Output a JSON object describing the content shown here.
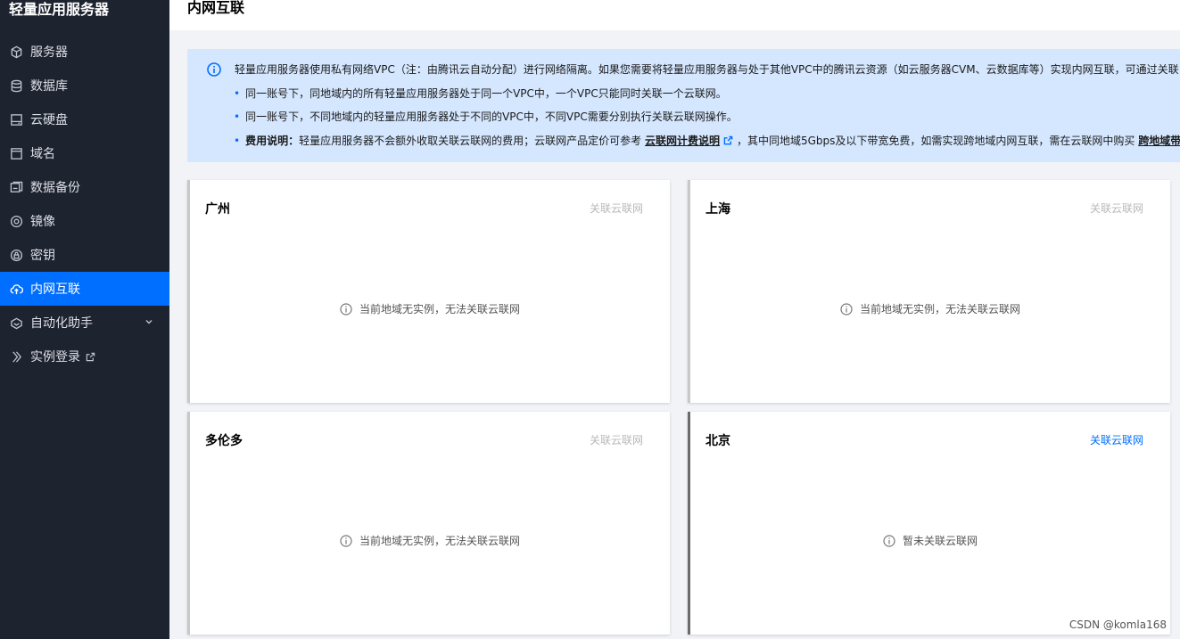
{
  "sidebar": {
    "title": "轻量应用服务器",
    "items": [
      {
        "label": "服务器",
        "icon": "cube-icon"
      },
      {
        "label": "数据库",
        "icon": "database-icon"
      },
      {
        "label": "云硬盘",
        "icon": "disk-icon"
      },
      {
        "label": "域名",
        "icon": "domain-icon"
      },
      {
        "label": "数据备份",
        "icon": "backup-icon"
      },
      {
        "label": "镜像",
        "icon": "image-icon"
      },
      {
        "label": "密钥",
        "icon": "key-icon"
      },
      {
        "label": "内网互联",
        "icon": "cloud-link-icon",
        "active": true
      },
      {
        "label": "自动化助手",
        "icon": "automation-icon",
        "has_submenu": true
      },
      {
        "label": "实例登录",
        "icon": "login-icon",
        "external": true
      }
    ]
  },
  "header": {
    "title": "内网互联"
  },
  "banner": {
    "intro": "轻量应用服务器使用私有网络VPC（注：由腾讯云自动分配）进行网络隔离。如果您需要将轻量应用服务器与处于其他VPC中的腾讯云资源（如云服务器CVM、云数据库等）实现内网互联，可通过关联",
    "bullet1": "同一账号下，同地域内的所有轻量应用服务器处于同一个VPC中，一个VPC只能同时关联一个云联网。",
    "bullet2": "同一账号下，不同地域内的轻量应用服务器处于不同的VPC中，不同VPC需要分别执行关联云联网操作。",
    "bullet3_label": "费用说明：",
    "bullet3_text_a": "轻量应用服务器不会额外收取关联云联网的费用；云联网产品定价可参考",
    "bullet3_link1": "云联网计费说明",
    "bullet3_text_b": "，其中同地域5Gbps及以下带宽免费，如需实现跨地域内网互联，需在云联网中购买",
    "bullet3_link2": "跨地域带宽"
  },
  "cards": [
    {
      "region": "广州",
      "action": "关联云联网",
      "enabled": false,
      "message": "当前地域无实例，无法关联云联网"
    },
    {
      "region": "上海",
      "action": "关联云联网",
      "enabled": false,
      "message": "当前地域无实例，无法关联云联网"
    },
    {
      "region": "多伦多",
      "action": "关联云联网",
      "enabled": false,
      "message": "当前地域无实例，无法关联云联网"
    },
    {
      "region": "北京",
      "action": "关联云联网",
      "enabled": true,
      "message": "暂未关联云联网"
    }
  ],
  "watermark": "CSDN @komla168",
  "colors": {
    "sidebar_bg": "#1e2330",
    "active": "#006eff",
    "banner_bg": "#d5e7ff",
    "page_bg": "#f2f3f7"
  }
}
